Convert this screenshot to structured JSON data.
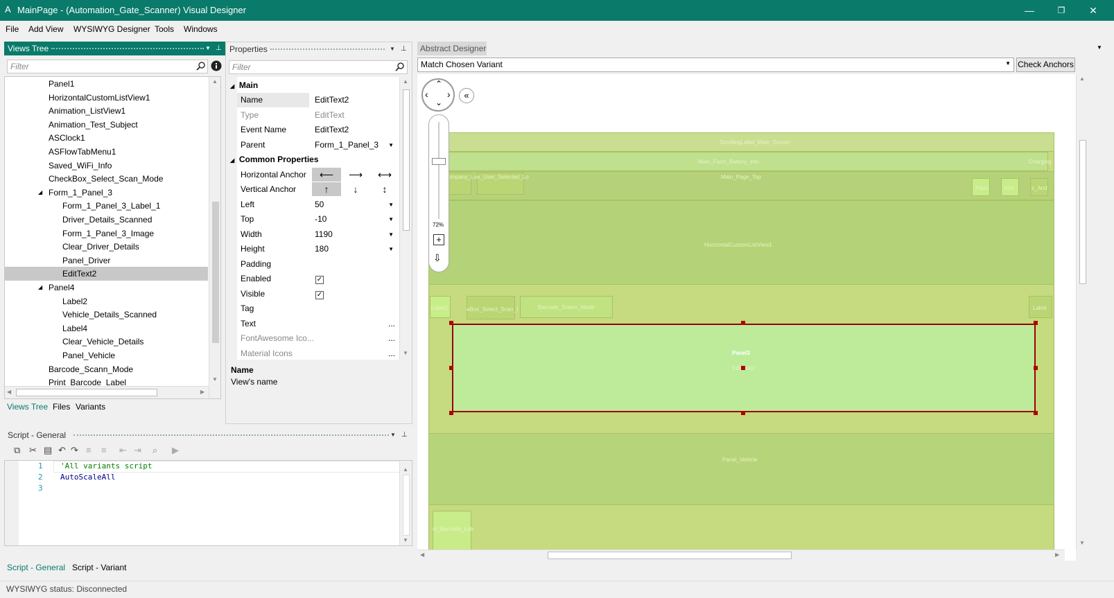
{
  "window": {
    "title": "MainPage - (Automation_Gate_Scanner) Visual Designer",
    "logo": "A",
    "minimize": "—",
    "restore": "❐",
    "close": "✕"
  },
  "menu": [
    "File",
    "Add View",
    "WYSIWYG Designer",
    "Tools",
    "Windows"
  ],
  "views_tree": {
    "title": "Views Tree",
    "filter_placeholder": "Filter",
    "items": [
      {
        "label": "Panel1",
        "indent": 1
      },
      {
        "label": "HorizontalCustomListView1",
        "indent": 1
      },
      {
        "label": "Animation_ListView1",
        "indent": 1
      },
      {
        "label": "Animation_Test_Subject",
        "indent": 1
      },
      {
        "label": "ASClock1",
        "indent": 1
      },
      {
        "label": "ASFlowTabMenu1",
        "indent": 1
      },
      {
        "label": "Saved_WiFi_Info",
        "indent": 1
      },
      {
        "label": "CheckBox_Select_Scan_Mode",
        "indent": 1
      },
      {
        "label": "Form_1_Panel_3",
        "indent": 1,
        "expanded": true
      },
      {
        "label": "Form_1_Panel_3_Label_1",
        "indent": 2
      },
      {
        "label": "Driver_Details_Scanned",
        "indent": 2
      },
      {
        "label": "Form_1_Panel_3_Image",
        "indent": 2
      },
      {
        "label": "Clear_Driver_Details",
        "indent": 2
      },
      {
        "label": "Panel_Driver",
        "indent": 2
      },
      {
        "label": "EditText2",
        "indent": 2,
        "selected": true
      },
      {
        "label": "Panel4",
        "indent": 1,
        "expanded": true
      },
      {
        "label": "Label2",
        "indent": 2
      },
      {
        "label": "Vehicle_Details_Scanned",
        "indent": 2
      },
      {
        "label": "Label4",
        "indent": 2
      },
      {
        "label": "Clear_Vehicle_Details",
        "indent": 2
      },
      {
        "label": "Panel_Vehicle",
        "indent": 2
      },
      {
        "label": "Barcode_Scann_Mode",
        "indent": 1
      },
      {
        "label": "Print_Barcode_Label",
        "indent": 1
      }
    ],
    "tabs": [
      "Views Tree",
      "Files",
      "Variants"
    ]
  },
  "properties": {
    "title": "Properties",
    "filter_placeholder": "Filter",
    "main_label": "Main",
    "common_label": "Common Properties",
    "rows": {
      "name": {
        "label": "Name",
        "value": "EditText2"
      },
      "type": {
        "label": "Type",
        "value": "EditText"
      },
      "event_name": {
        "label": "Event Name",
        "value": "EditText2"
      },
      "parent": {
        "label": "Parent",
        "value": "Form_1_Panel_3"
      },
      "h_anchor": {
        "label": "Horizontal Anchor"
      },
      "v_anchor": {
        "label": "Vertical Anchor"
      },
      "left": {
        "label": "Left",
        "value": "50"
      },
      "top": {
        "label": "Top",
        "value": "-10"
      },
      "width": {
        "label": "Width",
        "value": "1190"
      },
      "height": {
        "label": "Height",
        "value": "180"
      },
      "padding": {
        "label": "Padding",
        "value": ""
      },
      "enabled": {
        "label": "Enabled",
        "checked": true
      },
      "visible": {
        "label": "Visible",
        "checked": true
      },
      "tag": {
        "label": "Tag",
        "value": ""
      },
      "text": {
        "label": "Text",
        "value": "..."
      },
      "fontawesome": {
        "label": "FontAwesome Ico...",
        "value": "..."
      },
      "material": {
        "label": "Material Icons",
        "value": "..."
      }
    },
    "desc_title": "Name",
    "desc_text": "View's name"
  },
  "script": {
    "title": "Script - General",
    "lines": [
      {
        "num": "1",
        "text": "'All variants script"
      },
      {
        "num": "2",
        "text": "AutoScaleAll"
      },
      {
        "num": "3",
        "text": ""
      }
    ],
    "tabs": [
      "Script - General",
      "Script - Variant"
    ]
  },
  "designer": {
    "tab": "Abstract Designer",
    "variant": "Match Chosen Variant",
    "check_anchors": "Check Anchors",
    "zoom": "72%",
    "ghost_labels": {
      "scrolling": "ScrollingLabel_Main_Screen",
      "battery": "Main_Form_Battery_Info",
      "charging": "Charging",
      "company": "ompany_Lo",
      "user_sel": "e_User_Selected_Lo",
      "top": "Main_Page_Top",
      "pass": "Pass",
      "and": "And",
      "is_and": "s_And",
      "hclv": "HorizontalCustomListView1",
      "label1": "Label1",
      "chkbox": "eBox_Select_Scan_I",
      "barcode": "Barcode_Scann_Mode",
      "label_r": "Label",
      "panel3": "Panel3",
      "edittext": "EditText2",
      "panel_vehicle": "Panel_Vehicle",
      "print_barcode": "nt_Barcode_Lab"
    }
  },
  "status": "WYSIWYG status: Disconnected",
  "colors": {
    "accent": "#0a7a6a",
    "canvas": "#c6da80",
    "selection": "#b00000"
  }
}
